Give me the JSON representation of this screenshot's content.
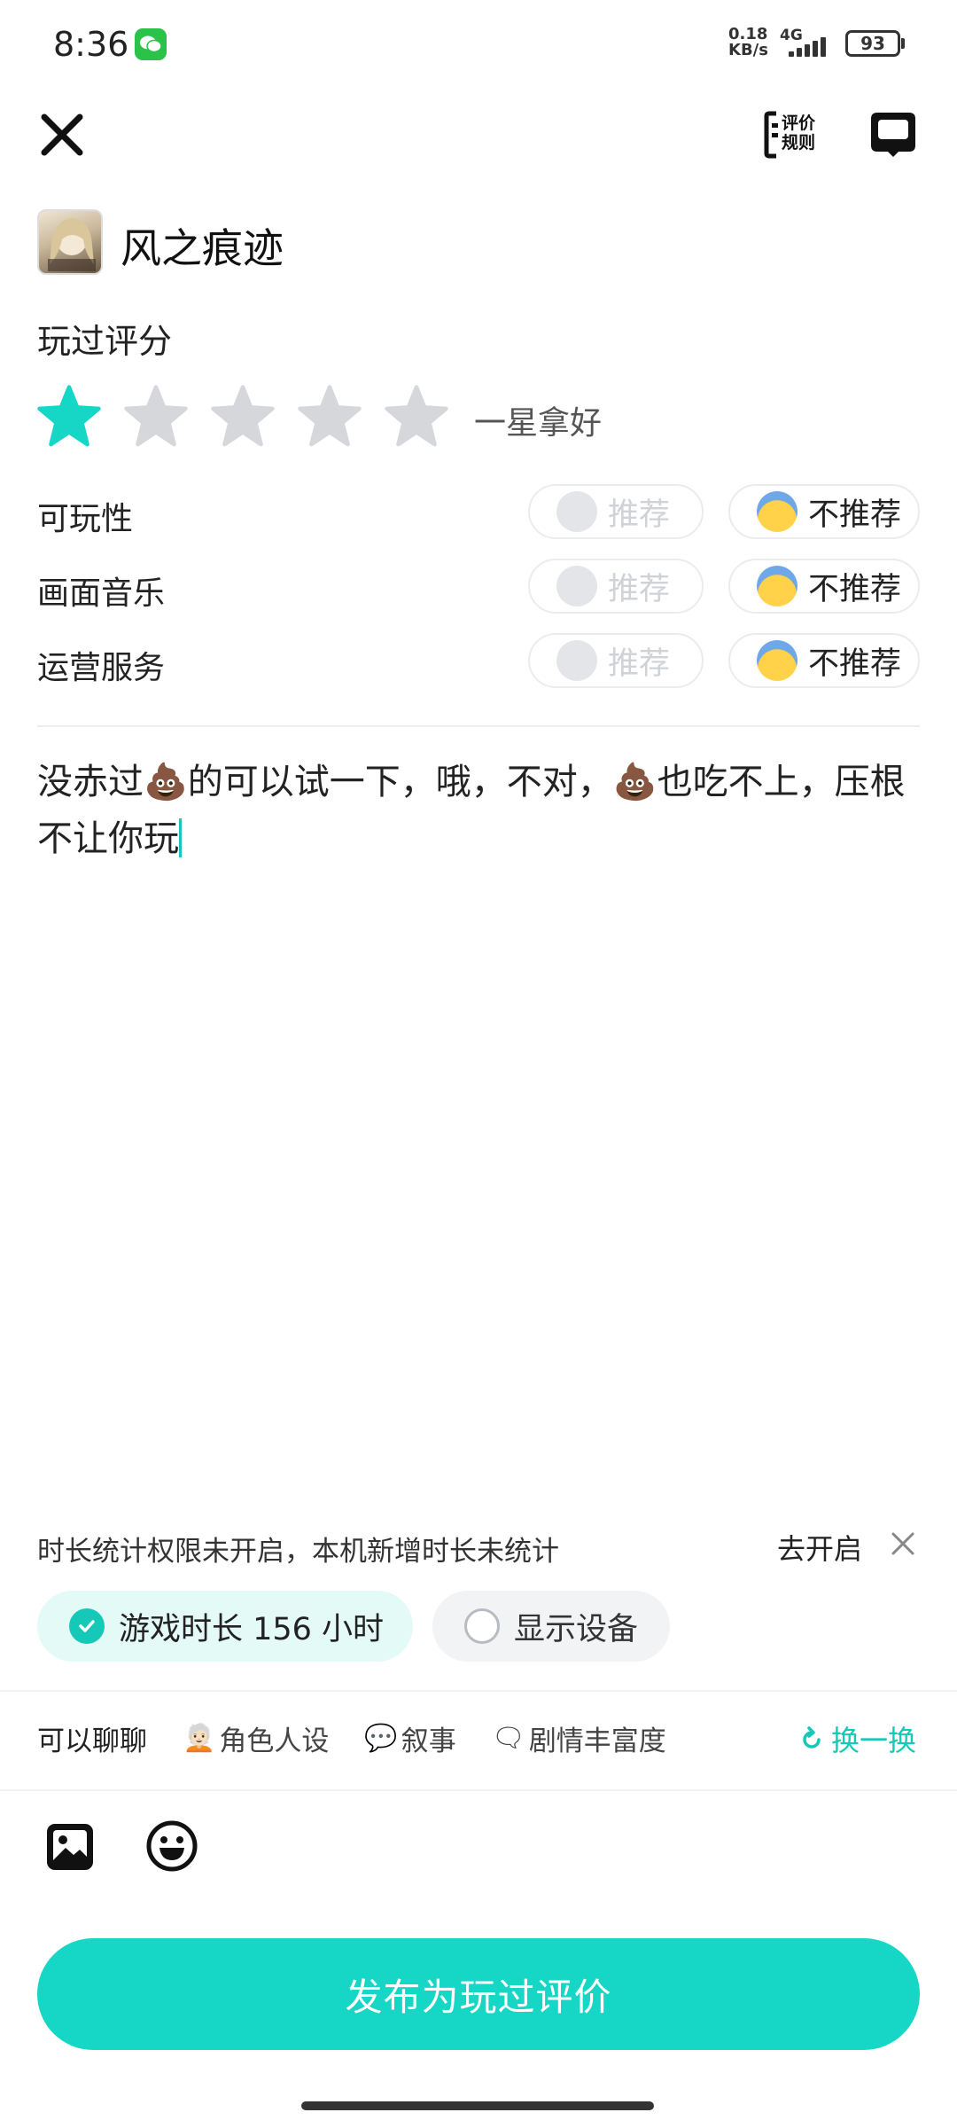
{
  "status_bar": {
    "time": "8:36",
    "network_speed_value": "0.18",
    "network_speed_unit": "KB/s",
    "network_type": "4G",
    "battery": "93"
  },
  "header": {
    "close_icon": "close-icon",
    "rules_label_line1": "评价",
    "rules_label_line2": "规则",
    "message_icon": "message-icon"
  },
  "game": {
    "name": "风之痕迹"
  },
  "rating": {
    "section_title": "玩过评分",
    "score": 1,
    "max": 5,
    "caption": "一星拿好",
    "active_color": "#16d6c5",
    "inactive_color": "#d5d7db"
  },
  "aspects": [
    {
      "label": "可玩性",
      "recommend": "推荐",
      "not_recommend": "不推荐",
      "selected": "not_recommend"
    },
    {
      "label": "画面音乐",
      "recommend": "推荐",
      "not_recommend": "不推荐",
      "selected": "not_recommend"
    },
    {
      "label": "运营服务",
      "recommend": "推荐",
      "not_recommend": "不推荐",
      "selected": "not_recommend"
    }
  ],
  "review": {
    "text": "没赤过💩的可以试一下，哦，不对，💩也吃不上，压根不让你玩"
  },
  "playtime_notice": {
    "text": "时长统计权限未开启，本机新增时长未统计",
    "action": "去开启"
  },
  "chips": {
    "playtime": "游戏时长 156 小时",
    "device": "显示设备"
  },
  "topics": {
    "lead": "可以聊聊",
    "items": [
      {
        "icon": "🧑🏻‍🦳",
        "label": "角色人设"
      },
      {
        "icon": "💬",
        "label": "叙事"
      },
      {
        "icon": "🗨",
        "label": "剧情丰富度"
      }
    ],
    "refresh": "换一换"
  },
  "toolbar": {
    "image_icon": "image-icon",
    "emoji_icon": "emoji-icon"
  },
  "publish_button": "发布为玩过评价",
  "colors": {
    "accent": "#16d6c5",
    "accent_text": "#16c8b8"
  }
}
